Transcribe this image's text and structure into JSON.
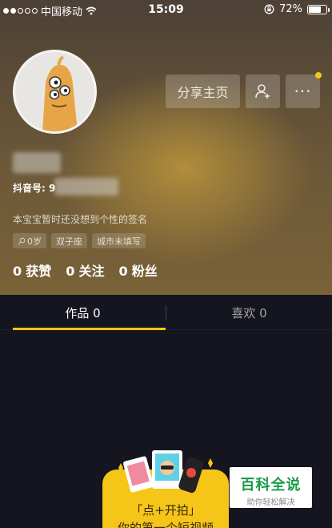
{
  "status_bar": {
    "carrier": "中国移动",
    "time": "15:09",
    "battery": "72%",
    "battery_level": 0.72
  },
  "profile": {
    "share_button": "分享主页",
    "id_label": "抖音号: 9",
    "signature": "本宝宝暂时还没想到个性的签名",
    "tags": [
      {
        "label": "0岁",
        "icon": "female-icon"
      },
      {
        "label": "双子座"
      },
      {
        "label": "城市未填写"
      }
    ],
    "stats": [
      {
        "count": "0",
        "label": "获赞"
      },
      {
        "count": "0",
        "label": "关注"
      },
      {
        "count": "0",
        "label": "粉丝"
      }
    ]
  },
  "tabs": [
    {
      "label": "作品 0",
      "active": true
    },
    {
      "label": "喜欢 0",
      "active": false
    }
  ],
  "promo": {
    "line1": "「点+开拍」",
    "line2": "你的第一个短视频"
  },
  "watermark": {
    "title": "百科全说",
    "subtitle": "助你轻松解决"
  },
  "colors": {
    "accent": "#f5c518",
    "background": "#15151f"
  }
}
